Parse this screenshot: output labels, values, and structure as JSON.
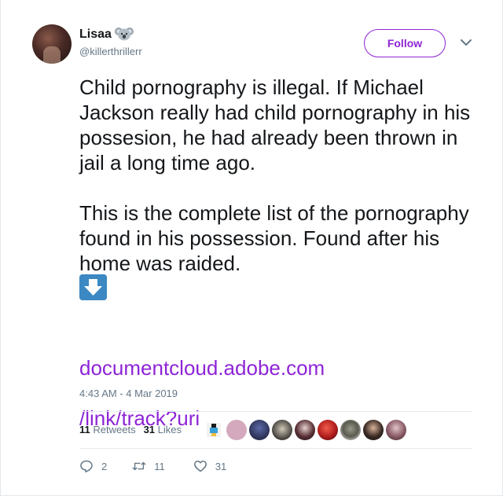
{
  "user": {
    "name": "Lisaa",
    "handle": "@killerthrillerr",
    "emoji_icon": "koala-icon"
  },
  "follow_label": "Follow",
  "tweet": {
    "text": "Child pornography is illegal. If Michael Jackson really had child pornography in his possesion, he had already been thrown in jail a long time ago.\n\nThis is the complete list of the pornography found in his possession. Found after his home was raided.",
    "link_line1": "documentcloud.adobe.com",
    "link_line2": "/link/track?uri  ...",
    "timestamp": "4:43 AM - 4 Mar 2019"
  },
  "stats": {
    "retweets_count": "11",
    "retweets_label": "Retweets",
    "likes_count": "31",
    "likes_label": "Likes"
  },
  "actions": {
    "reply_count": "2",
    "retweet_count": "11",
    "like_count": "31"
  },
  "colors": {
    "accent": "#8e24d6",
    "muted": "#657786",
    "text": "#14171a",
    "arrow_emoji": "#3b88c3"
  }
}
